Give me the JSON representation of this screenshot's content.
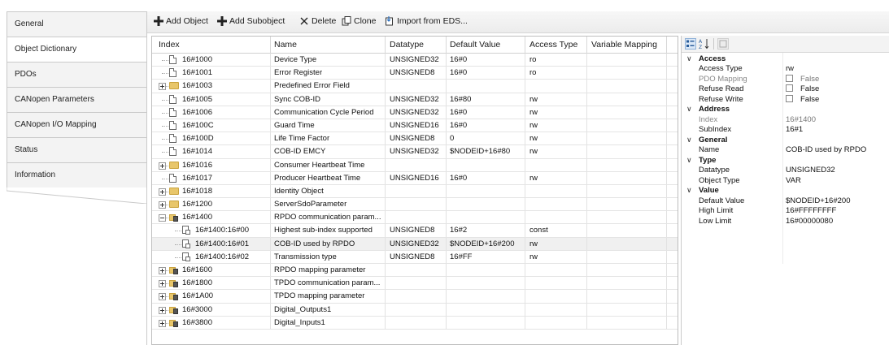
{
  "tabs": [
    {
      "label": "General",
      "active": false
    },
    {
      "label": "Object Dictionary",
      "active": true
    },
    {
      "label": "PDOs",
      "active": false
    },
    {
      "label": "CANopen Parameters",
      "active": false
    },
    {
      "label": "CANopen I/O Mapping",
      "active": false
    },
    {
      "label": "Status",
      "active": false
    },
    {
      "label": "Information",
      "active": false
    }
  ],
  "toolbar": {
    "add_object": "Add Object",
    "add_subobject": "Add Subobject",
    "delete": "Delete",
    "clone": "Clone",
    "import_eds": "Import from EDS..."
  },
  "grid": {
    "columns": [
      "Index",
      "Name",
      "Datatype",
      "Default Value",
      "Access Type",
      "Variable Mapping"
    ],
    "rows": [
      {
        "index": "16#1000",
        "name": "Device Type",
        "datatype": "UNSIGNED32",
        "default": "16#0",
        "access": "ro",
        "mapping": ""
      },
      {
        "index": "16#1001",
        "name": "Error Register",
        "datatype": "UNSIGNED8",
        "default": "16#0",
        "access": "ro",
        "mapping": ""
      },
      {
        "index": "16#1003",
        "name": "Predefined Error Field",
        "datatype": "",
        "default": "",
        "access": "",
        "mapping": ""
      },
      {
        "index": "16#1005",
        "name": "Sync COB-ID",
        "datatype": "UNSIGNED32",
        "default": "16#80",
        "access": "rw",
        "mapping": ""
      },
      {
        "index": "16#1006",
        "name": "Communication Cycle Period",
        "datatype": "UNSIGNED32",
        "default": "16#0",
        "access": "rw",
        "mapping": ""
      },
      {
        "index": "16#100C",
        "name": "Guard Time",
        "datatype": "UNSIGNED16",
        "default": "16#0",
        "access": "rw",
        "mapping": ""
      },
      {
        "index": "16#100D",
        "name": "Life Time Factor",
        "datatype": "UNSIGNED8",
        "default": "0",
        "access": "rw",
        "mapping": ""
      },
      {
        "index": "16#1014",
        "name": "COB-ID EMCY",
        "datatype": "UNSIGNED32",
        "default": "$NODEID+16#80",
        "access": "rw",
        "mapping": ""
      },
      {
        "index": "16#1016",
        "name": "Consumer Heartbeat Time",
        "datatype": "",
        "default": "",
        "access": "",
        "mapping": ""
      },
      {
        "index": "16#1017",
        "name": "Producer Heartbeat Time",
        "datatype": "UNSIGNED16",
        "default": "16#0",
        "access": "rw",
        "mapping": ""
      },
      {
        "index": "16#1018",
        "name": "Identity Object",
        "datatype": "",
        "default": "",
        "access": "",
        "mapping": ""
      },
      {
        "index": "16#1200",
        "name": "ServerSdoParameter",
        "datatype": "",
        "default": "",
        "access": "",
        "mapping": ""
      },
      {
        "index": "16#1400",
        "name": "RPDO communication param...",
        "datatype": "",
        "default": "",
        "access": "",
        "mapping": ""
      },
      {
        "index": "16#1400:16#00",
        "name": "Highest sub-index supported",
        "datatype": "UNSIGNED8",
        "default": "16#2",
        "access": "const",
        "mapping": ""
      },
      {
        "index": "16#1400:16#01",
        "name": "COB-ID used by RPDO",
        "datatype": "UNSIGNED32",
        "default": "$NODEID+16#200",
        "access": "rw",
        "mapping": ""
      },
      {
        "index": "16#1400:16#02",
        "name": "Transmission type",
        "datatype": "UNSIGNED8",
        "default": "16#FF",
        "access": "rw",
        "mapping": ""
      },
      {
        "index": "16#1600",
        "name": "RPDO mapping parameter",
        "datatype": "",
        "default": "",
        "access": "",
        "mapping": ""
      },
      {
        "index": "16#1800",
        "name": "TPDO communication param...",
        "datatype": "",
        "default": "",
        "access": "",
        "mapping": ""
      },
      {
        "index": "16#1A00",
        "name": "TPDO mapping parameter",
        "datatype": "",
        "default": "",
        "access": "",
        "mapping": ""
      },
      {
        "index": "16#3000",
        "name": "Digital_Outputs1",
        "datatype": "",
        "default": "",
        "access": "",
        "mapping": ""
      },
      {
        "index": "16#3800",
        "name": "Digital_Inputs1",
        "datatype": "",
        "default": "",
        "access": "",
        "mapping": ""
      }
    ]
  },
  "properties": {
    "access_cat": "Access",
    "access_type_label": "Access Type",
    "access_type_value": "rw",
    "pdo_mapping_label": "PDO Mapping",
    "pdo_mapping_value": "False",
    "refuse_read_label": "Refuse Read",
    "refuse_read_value": "False",
    "refuse_write_label": "Refuse Write",
    "refuse_write_value": "False",
    "address_cat": "Address",
    "index_label": "Index",
    "index_value": "16#1400",
    "subindex_label": "SubIndex",
    "subindex_value": "16#1",
    "general_cat": "General",
    "name_label": "Name",
    "name_value": "COB-ID used by RPDO",
    "type_cat": "Type",
    "datatype_label": "Datatype",
    "datatype_value": "UNSIGNED32",
    "objtype_label": "Object Type",
    "objtype_value": "VAR",
    "value_cat": "Value",
    "default_label": "Default Value",
    "default_value": "$NODEID+16#200",
    "high_label": "High Limit",
    "high_value": "16#FFFFFFFF",
    "low_label": "Low Limit",
    "low_value": "16#00000080"
  }
}
